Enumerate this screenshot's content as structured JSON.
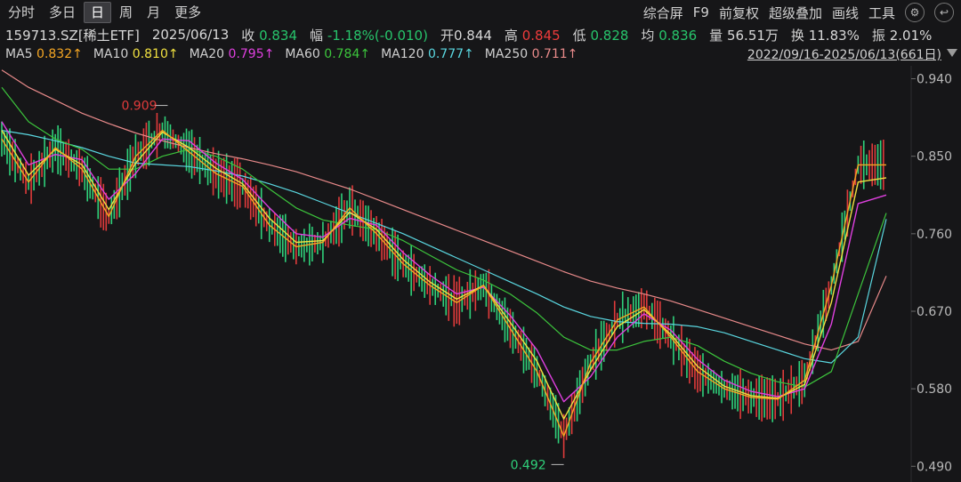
{
  "tabs": [
    "分时",
    "多日",
    "日",
    "周",
    "月",
    "更多"
  ],
  "active_tab": "日",
  "tools": {
    "composite": "综合屏",
    "f9": "F9",
    "adjust": "前复权",
    "overlay": "超级叠加",
    "draw": "画线",
    "toolbox": "工具",
    "settings_icon": "⚙"
  },
  "quote": {
    "code_name": "159713.SZ[稀土ETF]",
    "date": "2025/06/13",
    "close_label": "收",
    "close": "0.834",
    "change_label": "幅",
    "change": "-1.18%(-0.010)",
    "open_label": "开",
    "open": "0.844",
    "high_label": "高",
    "high": "0.845",
    "low_label": "低",
    "low": "0.828",
    "avg_label": "均",
    "avg": "0.836",
    "vol_label": "量",
    "vol": "56.51万",
    "turnover_label": "换",
    "turnover": "11.83%",
    "amplitude_label": "振",
    "amplitude": "2.01%"
  },
  "ma": [
    {
      "name": "MA5",
      "value": "0.832↑",
      "color": "#f5a623"
    },
    {
      "name": "MA10",
      "value": "0.810↑",
      "color": "#f0e040"
    },
    {
      "name": "MA20",
      "value": "0.795↑",
      "color": "#e040e0"
    },
    {
      "name": "MA60",
      "value": "0.784↑",
      "color": "#3cc43c"
    },
    {
      "name": "MA120",
      "value": "0.777↑",
      "color": "#5ad7e0"
    },
    {
      "name": "MA250",
      "value": "0.711↑",
      "color": "#e88a8a"
    }
  ],
  "range": "2022/09/16-2025/06/13(661日)",
  "chart_data": {
    "type": "line",
    "ylim": [
      0.48,
      0.955
    ],
    "y_ticks": [
      "0.940",
      "0.850",
      "0.760",
      "0.670",
      "0.580",
      "0.490"
    ],
    "annotations": {
      "max_label": "0.909",
      "min_label": "0.492"
    },
    "x": [
      0,
      20,
      40,
      60,
      80,
      100,
      120,
      140,
      160,
      180,
      200,
      220,
      240,
      260,
      280,
      300,
      320,
      340,
      360,
      380,
      400,
      420,
      440,
      460,
      480,
      500,
      520,
      540,
      560,
      580,
      600,
      620,
      640,
      661
    ],
    "series": [
      {
        "color": "#f5a623",
        "values": [
          0.87,
          0.82,
          0.86,
          0.835,
          0.78,
          0.85,
          0.88,
          0.855,
          0.83,
          0.815,
          0.77,
          0.745,
          0.75,
          0.79,
          0.76,
          0.725,
          0.7,
          0.68,
          0.7,
          0.65,
          0.6,
          0.525,
          0.61,
          0.66,
          0.675,
          0.64,
          0.6,
          0.58,
          0.57,
          0.568,
          0.59,
          0.7,
          0.84,
          0.84
        ]
      },
      {
        "color": "#f0e040",
        "values": [
          0.88,
          0.828,
          0.858,
          0.84,
          0.788,
          0.842,
          0.878,
          0.86,
          0.836,
          0.818,
          0.778,
          0.75,
          0.752,
          0.785,
          0.765,
          0.73,
          0.704,
          0.684,
          0.7,
          0.657,
          0.612,
          0.545,
          0.602,
          0.652,
          0.672,
          0.643,
          0.606,
          0.583,
          0.572,
          0.569,
          0.585,
          0.68,
          0.82,
          0.825
        ]
      },
      {
        "color": "#e040e0",
        "values": [
          0.89,
          0.84,
          0.852,
          0.846,
          0.8,
          0.83,
          0.87,
          0.868,
          0.842,
          0.823,
          0.79,
          0.76,
          0.756,
          0.778,
          0.77,
          0.738,
          0.712,
          0.69,
          0.698,
          0.665,
          0.625,
          0.565,
          0.594,
          0.64,
          0.667,
          0.648,
          0.614,
          0.59,
          0.577,
          0.571,
          0.58,
          0.655,
          0.795,
          0.805
        ]
      },
      {
        "color": "#3cc43c",
        "values": [
          0.93,
          0.89,
          0.87,
          0.858,
          0.835,
          0.835,
          0.85,
          0.858,
          0.85,
          0.835,
          0.812,
          0.79,
          0.776,
          0.77,
          0.765,
          0.752,
          0.735,
          0.718,
          0.706,
          0.69,
          0.668,
          0.64,
          0.625,
          0.625,
          0.635,
          0.64,
          0.63,
          0.612,
          0.598,
          0.588,
          0.582,
          0.6,
          0.69,
          0.784
        ]
      },
      {
        "color": "#5ad7e0",
        "values": [
          0.88,
          0.875,
          0.868,
          0.86,
          0.85,
          0.842,
          0.84,
          0.838,
          0.833,
          0.827,
          0.818,
          0.808,
          0.796,
          0.784,
          0.772,
          0.76,
          0.746,
          0.732,
          0.718,
          0.704,
          0.69,
          0.675,
          0.664,
          0.658,
          0.656,
          0.655,
          0.652,
          0.645,
          0.635,
          0.625,
          0.615,
          0.61,
          0.64,
          0.777
        ]
      },
      {
        "color": "#e88a8a",
        "values": [
          0.95,
          0.93,
          0.915,
          0.9,
          0.888,
          0.877,
          0.868,
          0.86,
          0.853,
          0.847,
          0.84,
          0.832,
          0.822,
          0.812,
          0.8,
          0.788,
          0.776,
          0.764,
          0.752,
          0.74,
          0.728,
          0.716,
          0.705,
          0.697,
          0.69,
          0.682,
          0.672,
          0.662,
          0.652,
          0.642,
          0.632,
          0.625,
          0.635,
          0.711
        ]
      }
    ]
  }
}
